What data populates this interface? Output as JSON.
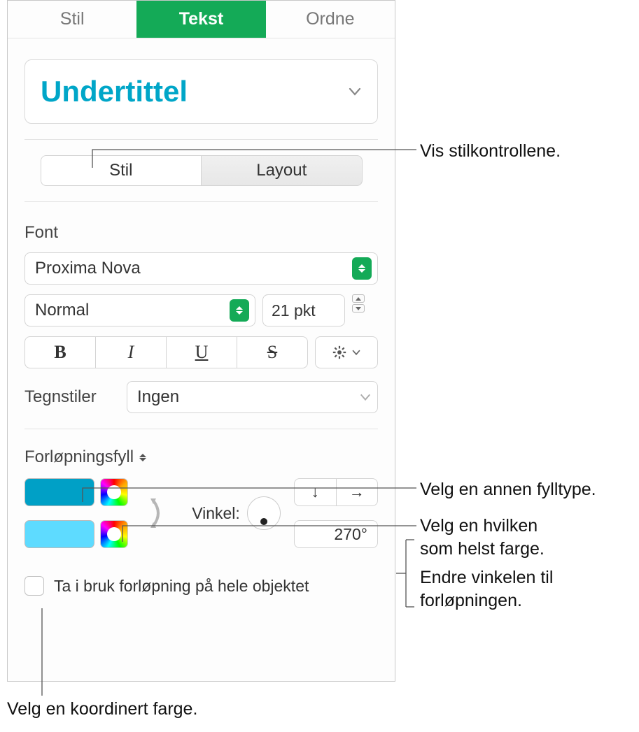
{
  "top_tabs": {
    "stil": "Stil",
    "tekst": "Tekst",
    "ordne": "Ordne"
  },
  "paragraph_style": "Undertittel",
  "sub_tabs": {
    "stil": "Stil",
    "layout": "Layout"
  },
  "font_section_label": "Font",
  "font_family": "Proxima Nova",
  "font_weight": "Normal",
  "font_size": "21 pkt",
  "char_styles_label": "Tegnstiler",
  "char_styles_value": "Ingen",
  "fill_type_label": "Forløpningsfyll",
  "angle_label": "Vinkel:",
  "angle_value": "270°",
  "apply_whole_object": "Ta i bruk forløpning på hele objektet",
  "callouts": {
    "show_style_controls": "Vis stilkontrollene.",
    "choose_fill_type": "Velg en annen fylltype.",
    "choose_any_color_l1": "Velg en hvilken",
    "choose_any_color_l2": "som helst farge.",
    "change_angle_l1": "Endre vinkelen til",
    "change_angle_l2": "forløpningen.",
    "choose_coord_color": "Velg en koordinert farge."
  },
  "colors": {
    "swatch1": "#00a0c6",
    "swatch2": "#5edbff",
    "accent": "#14aa57"
  }
}
